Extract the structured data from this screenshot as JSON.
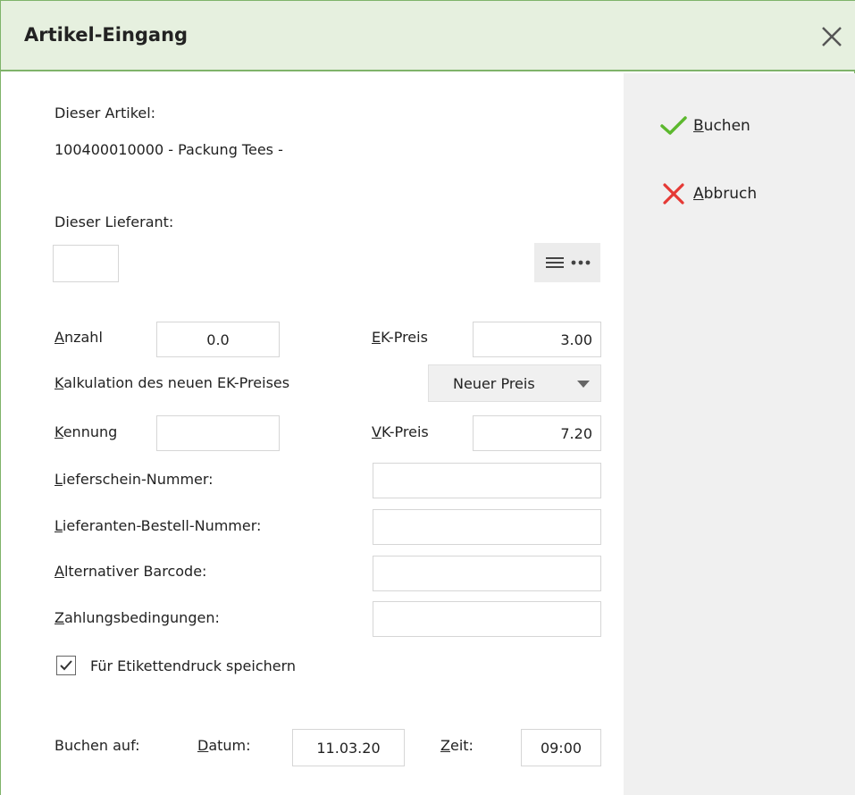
{
  "window": {
    "title": "Artikel-Eingang"
  },
  "actions": {
    "book": {
      "underline": "B",
      "rest": "uchen"
    },
    "cancel": {
      "underline": "A",
      "rest": "bbruch"
    }
  },
  "article": {
    "label": "Dieser Artikel:",
    "value": "100400010000 - Packung Tees -"
  },
  "supplier": {
    "label": "Dieser Lieferant:",
    "value": ""
  },
  "form": {
    "quantity": {
      "underline": "A",
      "rest": "nzahl",
      "value": "0.0"
    },
    "purchase_price": {
      "underline": "E",
      "rest": "K-Preis",
      "value": "3.00"
    },
    "calculation": {
      "underline": "K",
      "rest": "alkulation des neuen EK-Preises",
      "selected": "Neuer Preis"
    },
    "identifier": {
      "underline": "K",
      "rest": "ennung",
      "value": ""
    },
    "sales_price": {
      "underline": "V",
      "rest": "K-Preis",
      "value": "7.20"
    },
    "delivery_note": {
      "underline": "L",
      "rest": "ieferschein-Nummer:",
      "value": ""
    },
    "supplier_order": {
      "underline": "L",
      "rest": "ieferanten-Bestell-Nummer:",
      "value": ""
    },
    "alt_barcode": {
      "underline": "A",
      "rest": "lternativer Barcode:",
      "value": ""
    },
    "payment_terms": {
      "underline": "Z",
      "rest": "ahlungsbedingungen:",
      "value": ""
    },
    "label_print": {
      "label": "Für Etikettendruck speichern",
      "checked": true
    }
  },
  "booking": {
    "label": "Buchen auf:",
    "date": {
      "underline": "D",
      "rest": "atum:",
      "value": "11.03.20"
    },
    "time": {
      "underline": "Z",
      "rest": "eit:",
      "value": "09:00"
    }
  },
  "colors": {
    "title_bg": "#e6f0df",
    "accent_green": "#5cb82e",
    "cancel_red": "#e53935"
  }
}
